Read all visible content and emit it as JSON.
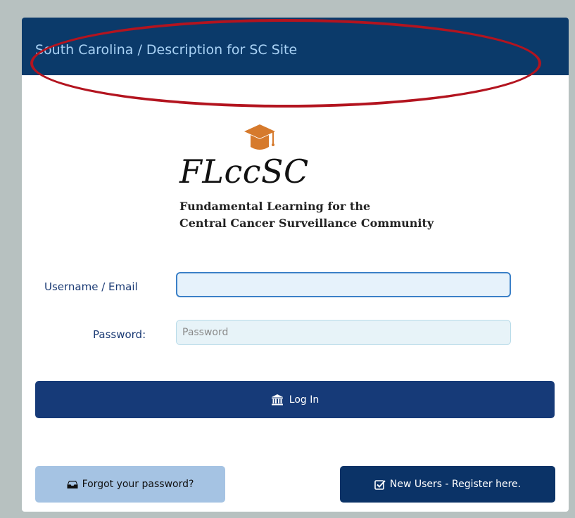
{
  "header": {
    "title": "South Carolina / Description for SC Site"
  },
  "logo": {
    "title": "FLccSC",
    "subtitle_line1": "Fundamental Learning for the",
    "subtitle_line2": "Central Cancer Surveillance Community",
    "icon": "graduation-cap-icon"
  },
  "form": {
    "username_label": "Username / Email",
    "username_value": "",
    "password_label": "Password:",
    "password_placeholder": "Password"
  },
  "buttons": {
    "login_label": "Log In",
    "login_icon": "bank-icon",
    "forgot_label": "Forgot your password?",
    "forgot_icon": "inbox-icon",
    "register_label": "New Users - Register here.",
    "register_icon": "checkbox-edit-icon"
  },
  "colors": {
    "header_bg": "#0b3a6a",
    "header_text": "#a9d2f5",
    "highlight_ellipse": "#b3141f",
    "primary_button": "#163a78",
    "secondary_button": "#a5c3e3",
    "cap_orange": "#d67a2c"
  }
}
